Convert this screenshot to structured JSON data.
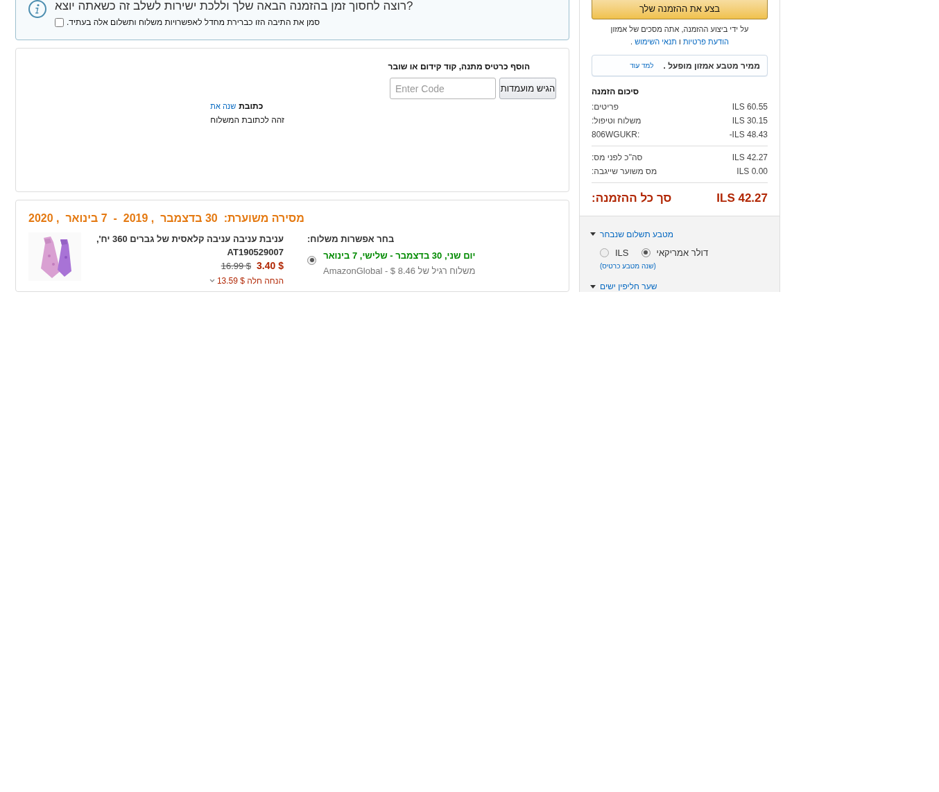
{
  "info": {
    "heading": "רוצה לחסוך זמן בהזמנה הבאה שלך וללכת ישירות לשלב זה כשאתה יוצא?",
    "checkbox": {
      "label": "סמן את התיבה הזו כברירת מחדל לאפשרויות משלוח ותשלום אלה בעתיד.",
      "checked": false
    }
  },
  "promo": {
    "title": "הוסף כרטיס מתנה, קוד קידום או שובר",
    "placeholder": "Enter Code",
    "button": "הגיש מועמדות"
  },
  "address": {
    "label": "כתובת",
    "change_link": "שנה את",
    "text": "זהה לכתובת המשלוח"
  },
  "delivery": {
    "heading": "מסירה משוערת:  30 בדצמבר  , 2019  -  7 בינואר  , 2020",
    "item": {
      "title": "עניבת עניבה עניבה קלאסית של גברים 360 יח', AT190529007",
      "old_price": "$ 16.99",
      "price": "$ 3.40",
      "saving": "הנחה חלה $ 13.59"
    },
    "shipping": {
      "heading": "בחר אפשרות משלוח:",
      "options": [
        {
          "label": "יום שני, 30 בדצמבר - שלישי, 7 בינואר",
          "sub": "משלוח רגיל של AmazonGlobal - $ 8.46",
          "selected": true
        }
      ]
    }
  },
  "sidebar": {
    "place_order": "בצע את ההזמנה שלך",
    "agreement": [
      "על ידי ביצוע ההזמנה, אתה מסכים של אמזון ",
      {
        "link": "הודעת פרטיות"
      },
      " ו ",
      {
        "link": "תנאי השימוש"
      },
      " ."
    ],
    "converter": {
      "text": "ממיר מטבע אמזון מופעל .",
      "link": "למד עוד"
    },
    "summary": {
      "title": "סיכום הזמנה",
      "groups": [
        [
          {
            "label": ":פריטים",
            "value": "ILS 60.55"
          },
          {
            "label": ":משלוח וטיפול",
            "value": "ILS 30.15"
          },
          {
            "label": "806WGUKR:",
            "value": "-ILS 48.43"
          }
        ],
        [
          {
            "label": ":סה\"כ לפני מס",
            "value": "ILS 42.27"
          },
          {
            "label": ":מס משוער שייגבה",
            "value": "ILS 0.00"
          }
        ]
      ],
      "total": {
        "label": ":סך כל ההזמנה",
        "value": "ILS 42.27"
      }
    },
    "currency": {
      "title": "מטבע תשלום שנבחר",
      "expanded": true,
      "options": [
        {
          "label": "דולר אמריקאי",
          "selected": true
        },
        {
          "label": "ILS",
          "selected": false
        }
      ],
      "change_link": "(שנה מטבע כרטיס)"
    },
    "exchange": {
      "title": "שער חליפין ישים",
      "expanded": true
    }
  }
}
